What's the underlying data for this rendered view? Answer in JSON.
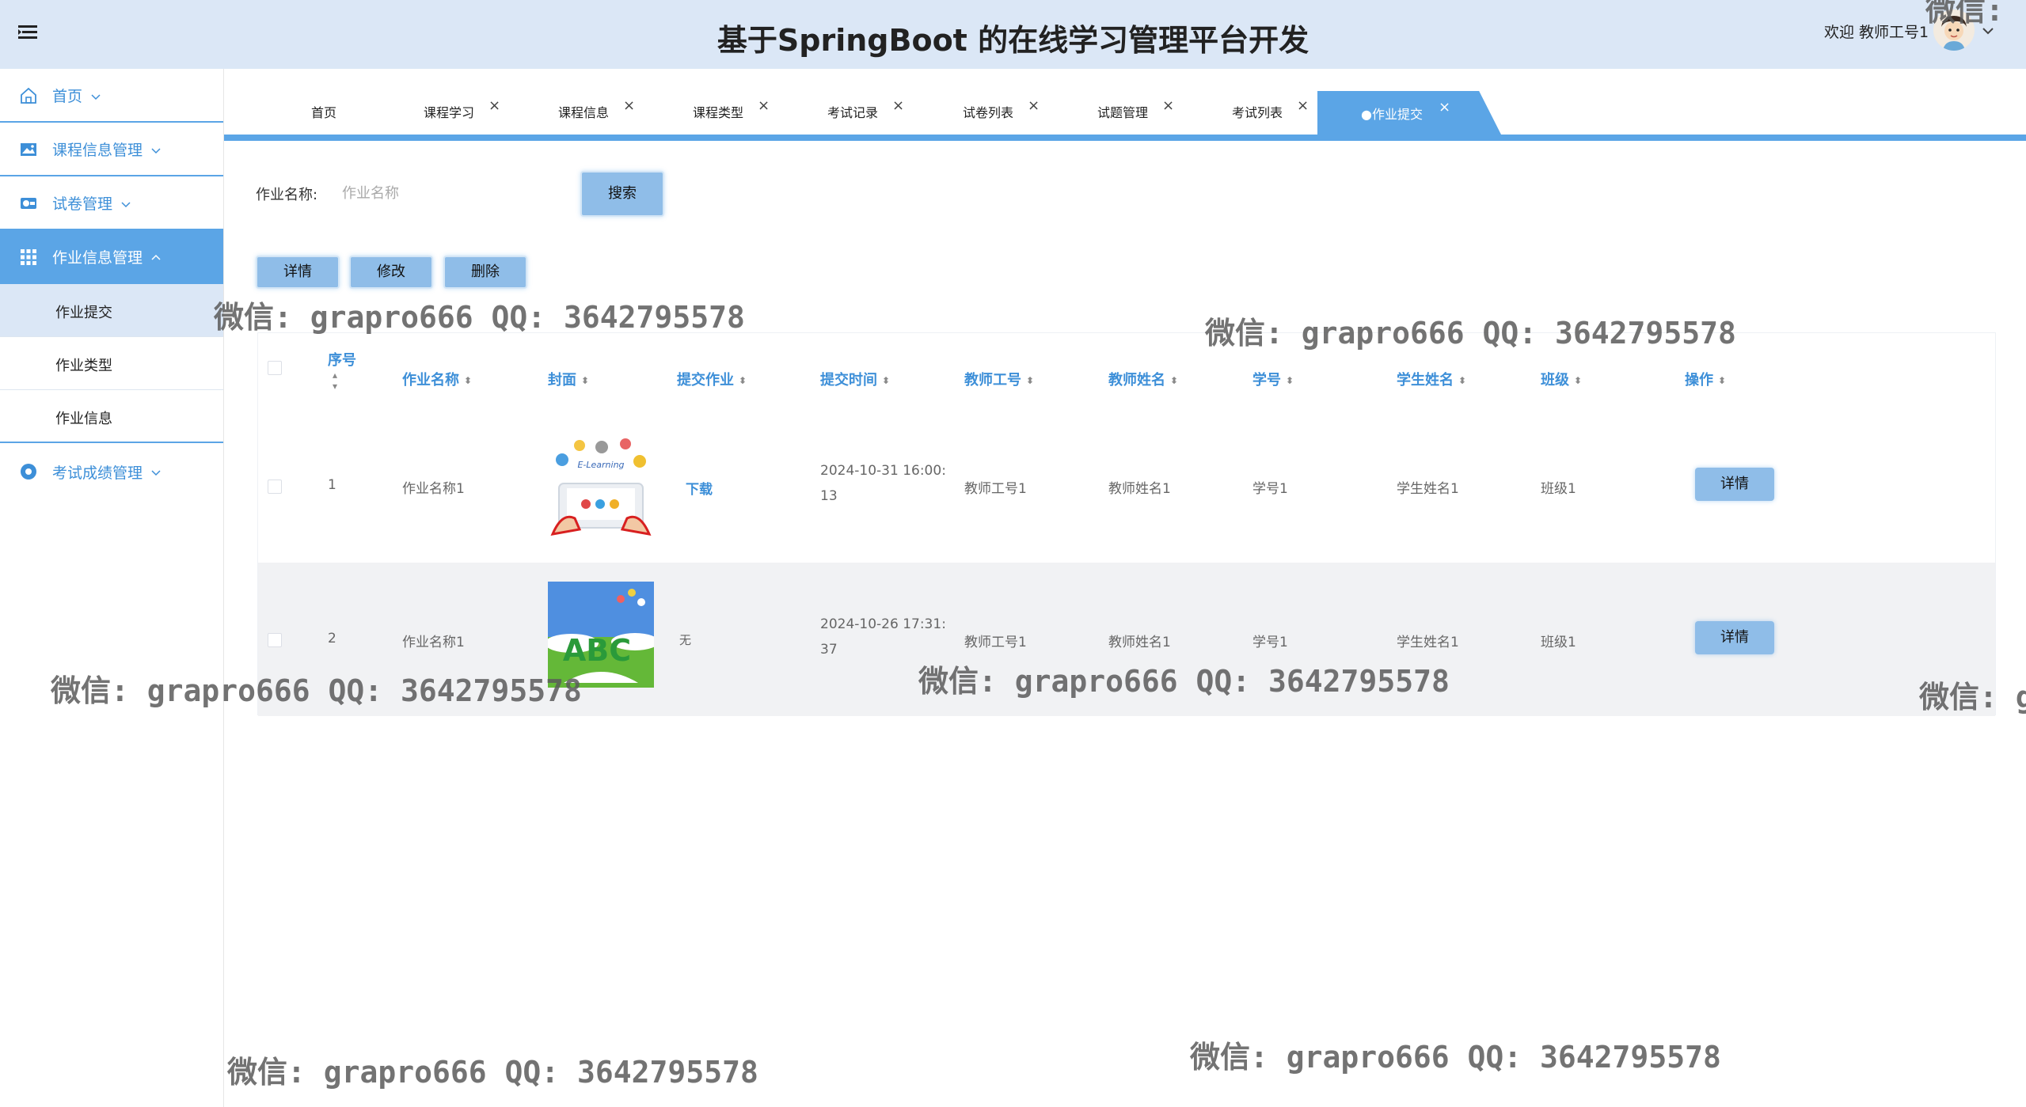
{
  "header": {
    "title": "基于SpringBoot 的在线学习管理平台开发",
    "welcome": "欢迎 教师工号1"
  },
  "sidebar": {
    "items": [
      {
        "label": "首页",
        "icon": "home-icon"
      },
      {
        "label": "课程信息管理",
        "icon": "image-icon"
      },
      {
        "label": "试卷管理",
        "icon": "toggle-icon"
      },
      {
        "label": "作业信息管理",
        "icon": "grid-icon"
      },
      {
        "label": "考试成绩管理",
        "icon": "circle-dot-icon"
      }
    ],
    "sub_items": [
      {
        "label": "作业提交"
      },
      {
        "label": "作业类型"
      },
      {
        "label": "作业信息"
      }
    ]
  },
  "tabs": [
    {
      "label": "首页"
    },
    {
      "label": "课程学习"
    },
    {
      "label": "课程信息"
    },
    {
      "label": "课程类型"
    },
    {
      "label": "考试记录"
    },
    {
      "label": "试卷列表"
    },
    {
      "label": "试题管理"
    },
    {
      "label": "考试列表"
    },
    {
      "label": "●作业提交"
    }
  ],
  "search": {
    "label": "作业名称:",
    "placeholder": "作业名称",
    "button": "搜索"
  },
  "actions": {
    "detail": "详情",
    "edit": "修改",
    "delete": "删除"
  },
  "table": {
    "headers": [
      "序号",
      "作业名称",
      "封面",
      "提交作业",
      "提交时间",
      "教师工号",
      "教师姓名",
      "学号",
      "学生姓名",
      "班级",
      "操作"
    ],
    "rows": [
      {
        "index": "1",
        "name": "作业名称1",
        "submit": "下载",
        "time_line1": "2024-10-31 16:00:",
        "time_line2": "13",
        "teacher_id": "教师工号1",
        "teacher_name": "教师姓名1",
        "student_id": "学号1",
        "student_name": "学生姓名1",
        "class": "班级1",
        "op": "详情"
      },
      {
        "index": "2",
        "name": "作业名称1",
        "submit": "无",
        "time_line1": "2024-10-26 17:31:",
        "time_line2": "37",
        "teacher_id": "教师工号1",
        "teacher_name": "教师姓名1",
        "student_id": "学号1",
        "student_name": "学生姓名1",
        "class": "班级1",
        "op": "详情"
      }
    ],
    "cover1_text": "E-Learning",
    "cover2_text": "ABC"
  },
  "watermarks": {
    "text": "微信: grapro666 QQ: 3642795578",
    "partial": "微信: g",
    "partial_top": "微信:"
  }
}
